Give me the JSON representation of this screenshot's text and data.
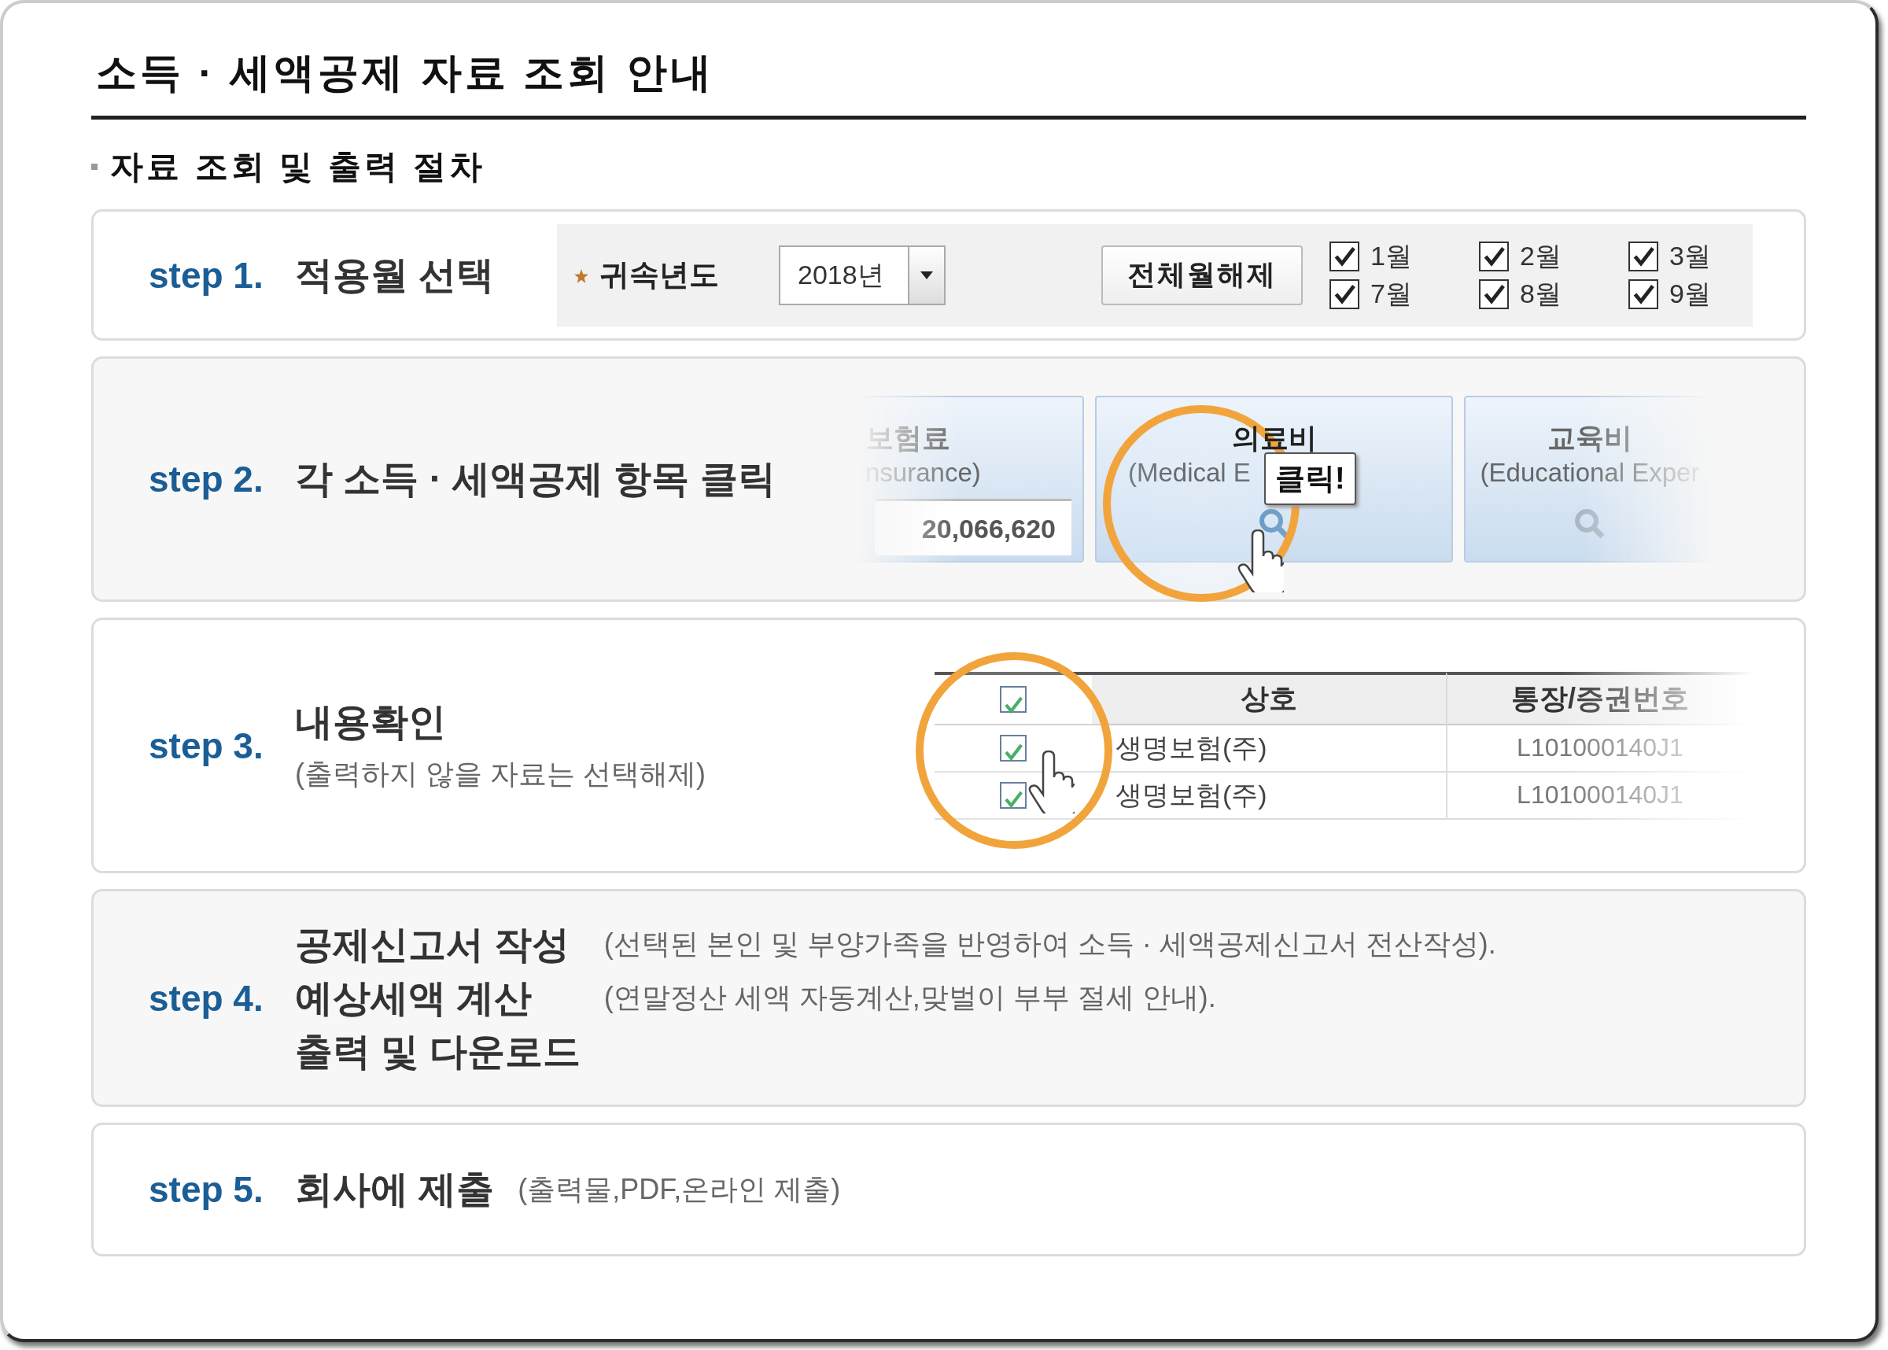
{
  "title": "소득 · 세액공제 자료 조회 안내",
  "section": "자료 조회 및 출력 절차",
  "steps": [
    {
      "kind": "months",
      "number": "step 1.",
      "title": "적용월 선택",
      "year_label": "귀속년도",
      "year": "2018년",
      "button": "전체월해제",
      "months": [
        {
          "label": "1월",
          "checked": true
        },
        {
          "label": "2월",
          "checked": true
        },
        {
          "label": "3월",
          "checked": true
        },
        {
          "label": "7월",
          "checked": true
        },
        {
          "label": "8월",
          "checked": true
        },
        {
          "label": "9월",
          "checked": true
        }
      ]
    },
    {
      "kind": "cards",
      "number": "step 2.",
      "title": "각 소득 · 세액공제 항목 클릭",
      "tooltip": "클릭!",
      "cards": [
        {
          "name": "보험료",
          "english": "nsurance)",
          "amount": "20,066,620",
          "highlighted": false
        },
        {
          "name": "의료비",
          "english": "(Medical E",
          "highlighted": true
        },
        {
          "name": "교육비",
          "english": "(Educational Exper",
          "highlighted": false
        }
      ]
    },
    {
      "kind": "table",
      "number": "step 3.",
      "title": "내용확인",
      "note": "(출력하지 않을 자료는 선택해제)",
      "columns": [
        "상호",
        "통장/증권번호"
      ],
      "header_checked": true,
      "rows": [
        {
          "checked": true,
          "cells": [
            "생명보험(주)",
            "L101000140J1"
          ]
        },
        {
          "checked": true,
          "cells": [
            "생명보험(주)",
            "L101000140J1"
          ]
        }
      ]
    },
    {
      "kind": "lines",
      "number": "step 4.",
      "lines": [
        {
          "title": "공제신고서 작성",
          "note": "(선택된 본인 및 부양가족을 반영하여 소득 · 세액공제신고서 전산작성)."
        },
        {
          "title": "예상세액 계산",
          "note": "(연말정산 세액 자동계산,맞벌이 부부 절세 안내)."
        },
        {
          "title": "출력 및 다운로드"
        }
      ]
    },
    {
      "kind": "lines",
      "number": "step 5.",
      "lines": [
        {
          "title": "회사에 제출",
          "note": "(출력물,PDF,온라인 제출)"
        }
      ]
    }
  ]
}
